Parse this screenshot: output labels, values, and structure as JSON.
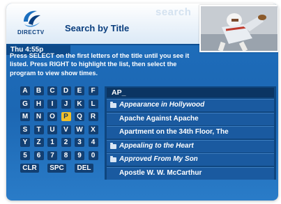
{
  "header": {
    "brand": "DIRECTV",
    "search_word": "search",
    "title": "Search by Title"
  },
  "status": {
    "time": "Thu 4:55p"
  },
  "instructions": "Press SELECT on the first letters of the title until you see it listed. Press RIGHT to highlight the list, then select the program to view show times.",
  "keypad": {
    "keys": [
      "A",
      "B",
      "C",
      "D",
      "E",
      "F",
      "G",
      "H",
      "I",
      "J",
      "K",
      "L",
      "M",
      "N",
      "O",
      "P",
      "Q",
      "R",
      "S",
      "T",
      "U",
      "V",
      "W",
      "X",
      "Y",
      "Z",
      "1",
      "2",
      "3",
      "4",
      "5",
      "6",
      "7",
      "8",
      "9",
      "0"
    ],
    "selected": "P",
    "actions": [
      "CLR",
      "SPC",
      "DEL"
    ]
  },
  "search": {
    "entry": "AP_"
  },
  "results": [
    {
      "label": "Appearance in Hollywood",
      "folder": true
    },
    {
      "label": "Apache Against Apache",
      "folder": false
    },
    {
      "label": "Apartment on the 34th Floor, The",
      "folder": false
    },
    {
      "label": "Appealing to the Heart",
      "folder": true
    },
    {
      "label": "Approved From My Son",
      "folder": true
    },
    {
      "label": "Apostle W. W. McCarthur",
      "folder": false
    }
  ],
  "colors": {
    "screen_blue": "#1f6fbd",
    "highlight": "#f2c02a",
    "brand_navy": "#0a3e7e"
  }
}
